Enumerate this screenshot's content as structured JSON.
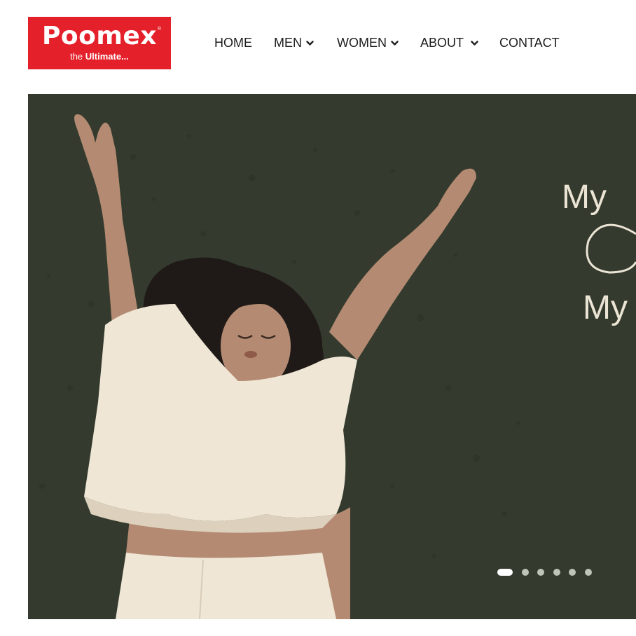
{
  "brand": {
    "name": "Poomex",
    "registered_mark": "®",
    "tagline_prefix": "the ",
    "tagline_bold": "Ultimate..."
  },
  "nav": {
    "items": [
      {
        "label": "HOME",
        "has_dropdown": false
      },
      {
        "label": "MEN",
        "has_dropdown": true
      },
      {
        "label": "WOMEN",
        "has_dropdown": true
      },
      {
        "label": "ABOUT",
        "has_dropdown": true
      },
      {
        "label": "CONTACT",
        "has_dropdown": false
      }
    ]
  },
  "hero": {
    "line1": "My",
    "line2": "My",
    "background_color": "#343b2e",
    "text_color": "#ece4d4"
  },
  "carousel": {
    "slide_count": 6,
    "active_index": 0
  },
  "colors": {
    "brand_red": "#e4202a"
  }
}
